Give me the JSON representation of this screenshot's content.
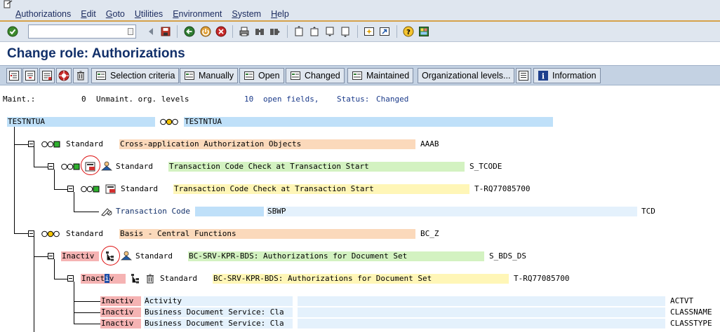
{
  "menu": {
    "items": [
      "Authorizations",
      "Edit",
      "Goto",
      "Utilities",
      "Environment",
      "System",
      "Help"
    ]
  },
  "toolbar": {
    "command_value": "",
    "icons": [
      "enter-icon",
      "back-nav-icon",
      "save-icon",
      "back-icon",
      "exit-icon",
      "cancel-icon",
      "print-icon",
      "find-icon",
      "find-next-icon",
      "first-page-icon",
      "prev-page-icon",
      "next-page-icon",
      "last-page-icon",
      "new-session-icon",
      "shortcut-icon",
      "help-icon",
      "layout-icon"
    ]
  },
  "title": "Change role: Authorizations",
  "app_toolbar": {
    "buttons": {
      "selection_criteria": "Selection criteria",
      "manually": "Manually",
      "open": "Open",
      "changed": "Changed",
      "maintained": "Maintained",
      "org_levels": "Organizational levels...",
      "information": "Information"
    }
  },
  "status_line": {
    "maint_label": "Maint.:",
    "maint_count": "0",
    "unmaint_label": "Unmaint. org. levels",
    "open_count": "10",
    "open_label": "open fields,",
    "status_label": "Status:",
    "status_value": "Changed"
  },
  "tree": {
    "root": {
      "name": "TESTNTUA",
      "name2": "TESTNTUA"
    },
    "rows": [
      {
        "level": "Standard",
        "text": "Cross-application Authorization Objects",
        "code": "AAAB"
      },
      {
        "level": "Standard",
        "text": "Transaction Code Check at Transaction Start",
        "code": "S_TCODE"
      },
      {
        "level": "Standard",
        "text": "Transaction Code Check at Transaction Start",
        "code": "T-RQ77085700"
      },
      {
        "field": "Transaction Code",
        "value": "SBWP",
        "code": "TCD"
      },
      {
        "level": "Standard",
        "text": "Basis - Central Functions",
        "code": "BC_Z"
      },
      {
        "status": "Inactiv",
        "level": "Standard",
        "text": "BC-SRV-KPR-BDS: Authorizations for Document Set",
        "code": "S_BDS_DS"
      },
      {
        "status_a": "Inact",
        "status_cursor": "i",
        "status_b": "v",
        "level": "Standard",
        "text": "BC-SRV-KPR-BDS: Authorizations for Document Set",
        "code": "T-RQ77085700"
      },
      {
        "status": "Inactiv",
        "field": "Activity",
        "code": "ACTVT"
      },
      {
        "status": "Inactiv",
        "field": "Business Document Service: Cla",
        "code": "CLASSNAME"
      },
      {
        "status": "Inactiv",
        "field": "Business Document Service: Cla",
        "code": "CLASSTYPE"
      }
    ]
  },
  "colors": {
    "menu_bg": "#dfe6ef",
    "title_text": "#12306a",
    "accent": "#d6a24a",
    "highlight_blue": "#bfe0f9",
    "highlight_orange": "#fbd9bb",
    "highlight_green": "#d3f2c1",
    "highlight_yellow": "#fff6b7",
    "highlight_red": "#f5b3b3"
  }
}
